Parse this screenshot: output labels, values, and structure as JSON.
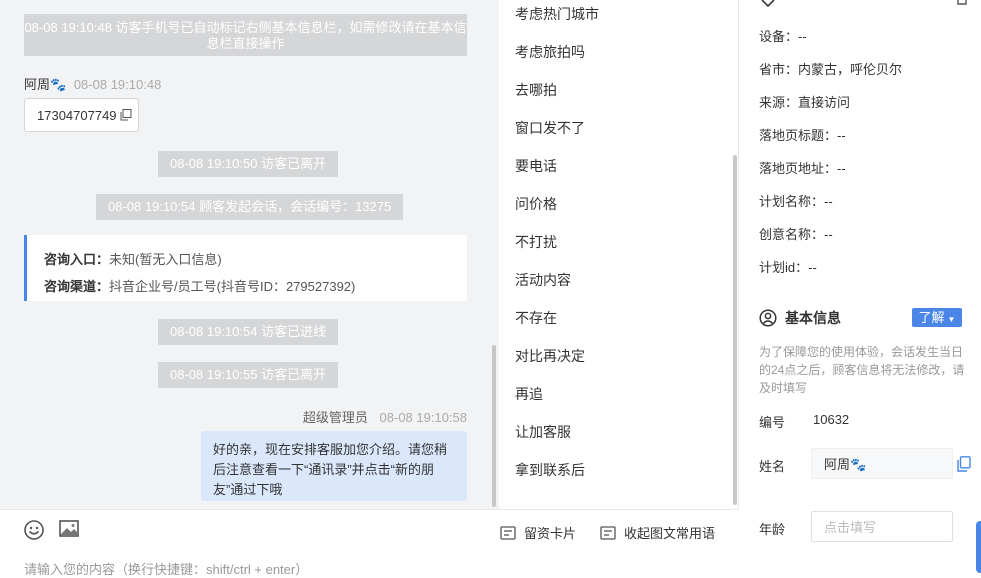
{
  "chat": {
    "sys1": "08-08 19:10:48 访客手机号已自动标记右侧基本信息栏，如需修改请在基本信息栏直接操作",
    "visitor_name": "阿周",
    "visitor_time": "08-08 19:10:48",
    "phone": "17304707749",
    "sys2": "08-08 19:10:50 访客已离开",
    "sys3": "08-08 19:10:54 顾客发起会话，会话编号：13275",
    "card": {
      "entry_label": "咨询入口：",
      "entry_value": "未知(暂无入口信息)",
      "channel_label": "咨询渠道：",
      "channel_value": "抖音企业号/员工号(抖音号ID：279527392)"
    },
    "sys4": "08-08 19:10:54 访客已进线",
    "sys5": "08-08 19:10:55 访客已离开",
    "agent_name": "超级管理员",
    "agent_time": "08-08 19:10:58",
    "agent_msg": "好的亲，现在安排客服加您介绍。请您稍后注意查看一下“通讯录”并点击“新的朋友”通过下哦"
  },
  "quick_replies": [
    "考虑热门城市",
    "考虑旅拍吗",
    "去哪拍",
    "窗口发不了",
    "要电话",
    "问价格",
    "不打扰",
    "活动内容",
    "不存在",
    "对比再决定",
    "再追",
    "让加客服",
    "拿到联系后"
  ],
  "toolbar": {
    "card_label": "留资卡片",
    "collapse_label": "收起图文常用语",
    "input_placeholder": "请输入您的内容（换行快捷键：shift/ctrl + enter）"
  },
  "visit_info": {
    "device": "设备：--",
    "region": "省市：内蒙古，呼伦贝尔",
    "source": "来源：直接访问",
    "landing_title": "落地页标题：--",
    "landing_url": "落地页地址：--",
    "plan_name": "计划名称：--",
    "creative_name": "创意名称：--",
    "plan_id": "计划id：--"
  },
  "basic_info": {
    "title": "基本信息",
    "learn_more": "了解",
    "notice": "为了保障您的使用体验，会话发生当日的24点之后，顾客信息将无法修改，请及时填写",
    "id_label": "编号",
    "id_value": "10632",
    "name_label": "姓名",
    "name_value": "阿周",
    "age_label": "年龄",
    "age_placeholder": "点击填写"
  },
  "colors": {
    "accent": "#4a86e8",
    "bubble_self": "#dbe8fc",
    "system": "#d5d6d8"
  }
}
